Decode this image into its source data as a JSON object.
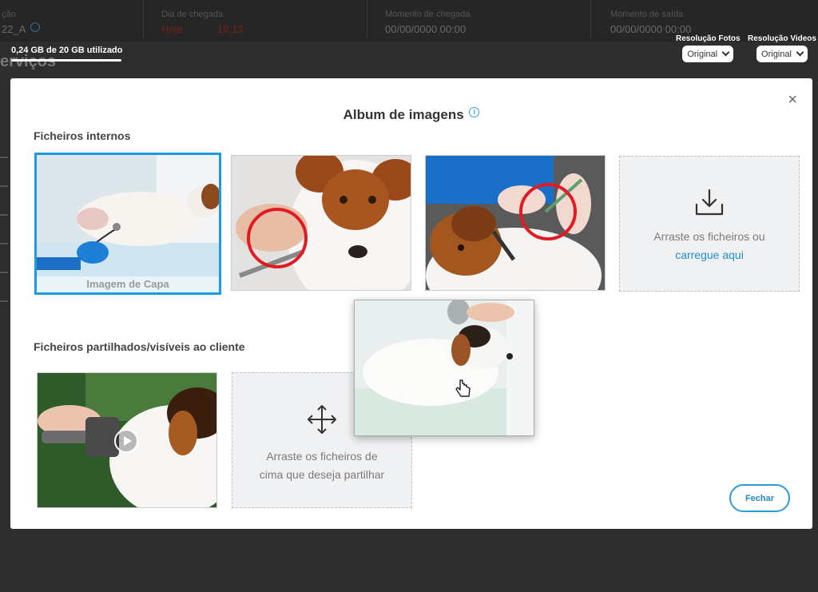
{
  "background": {
    "header_labels": [
      "ção",
      "Dia de chegada",
      "Momento de chegada",
      "Momento de saída"
    ],
    "id_value": "22_A",
    "arrival_day": "Hoje",
    "arrival_time": "19:13",
    "arrival_moment": "00/00/0000 00:00",
    "departure_moment": "00/00/0000 00:00",
    "section_title": "erviços",
    "storage_text": "0,24 GB de 20 GB utilizado",
    "storage_fraction": 0.012,
    "photo_resolution": {
      "label": "Resolução Fotos",
      "value": "Original"
    },
    "video_resolution": {
      "label": "Resolução Videos",
      "value": "Original"
    }
  },
  "modal": {
    "title": "Album de imagens",
    "info_icon": "i",
    "close_icon": "×",
    "internal_section": "Ficheiros internos",
    "cover_label": "Imagem de Capa",
    "upload_text": "Arraste os ficheiros ou",
    "upload_link": "carregue aqui",
    "shared_section": "Ficheiros partilhados/visíveis ao cliente",
    "share_text_1": "Arraste os ficheiros de",
    "share_text_2": "cima que deseja partilhar",
    "close_button": "Fechar"
  },
  "colors": {
    "accent": "#1e9be0",
    "highlight_circle": "#e01b24"
  }
}
